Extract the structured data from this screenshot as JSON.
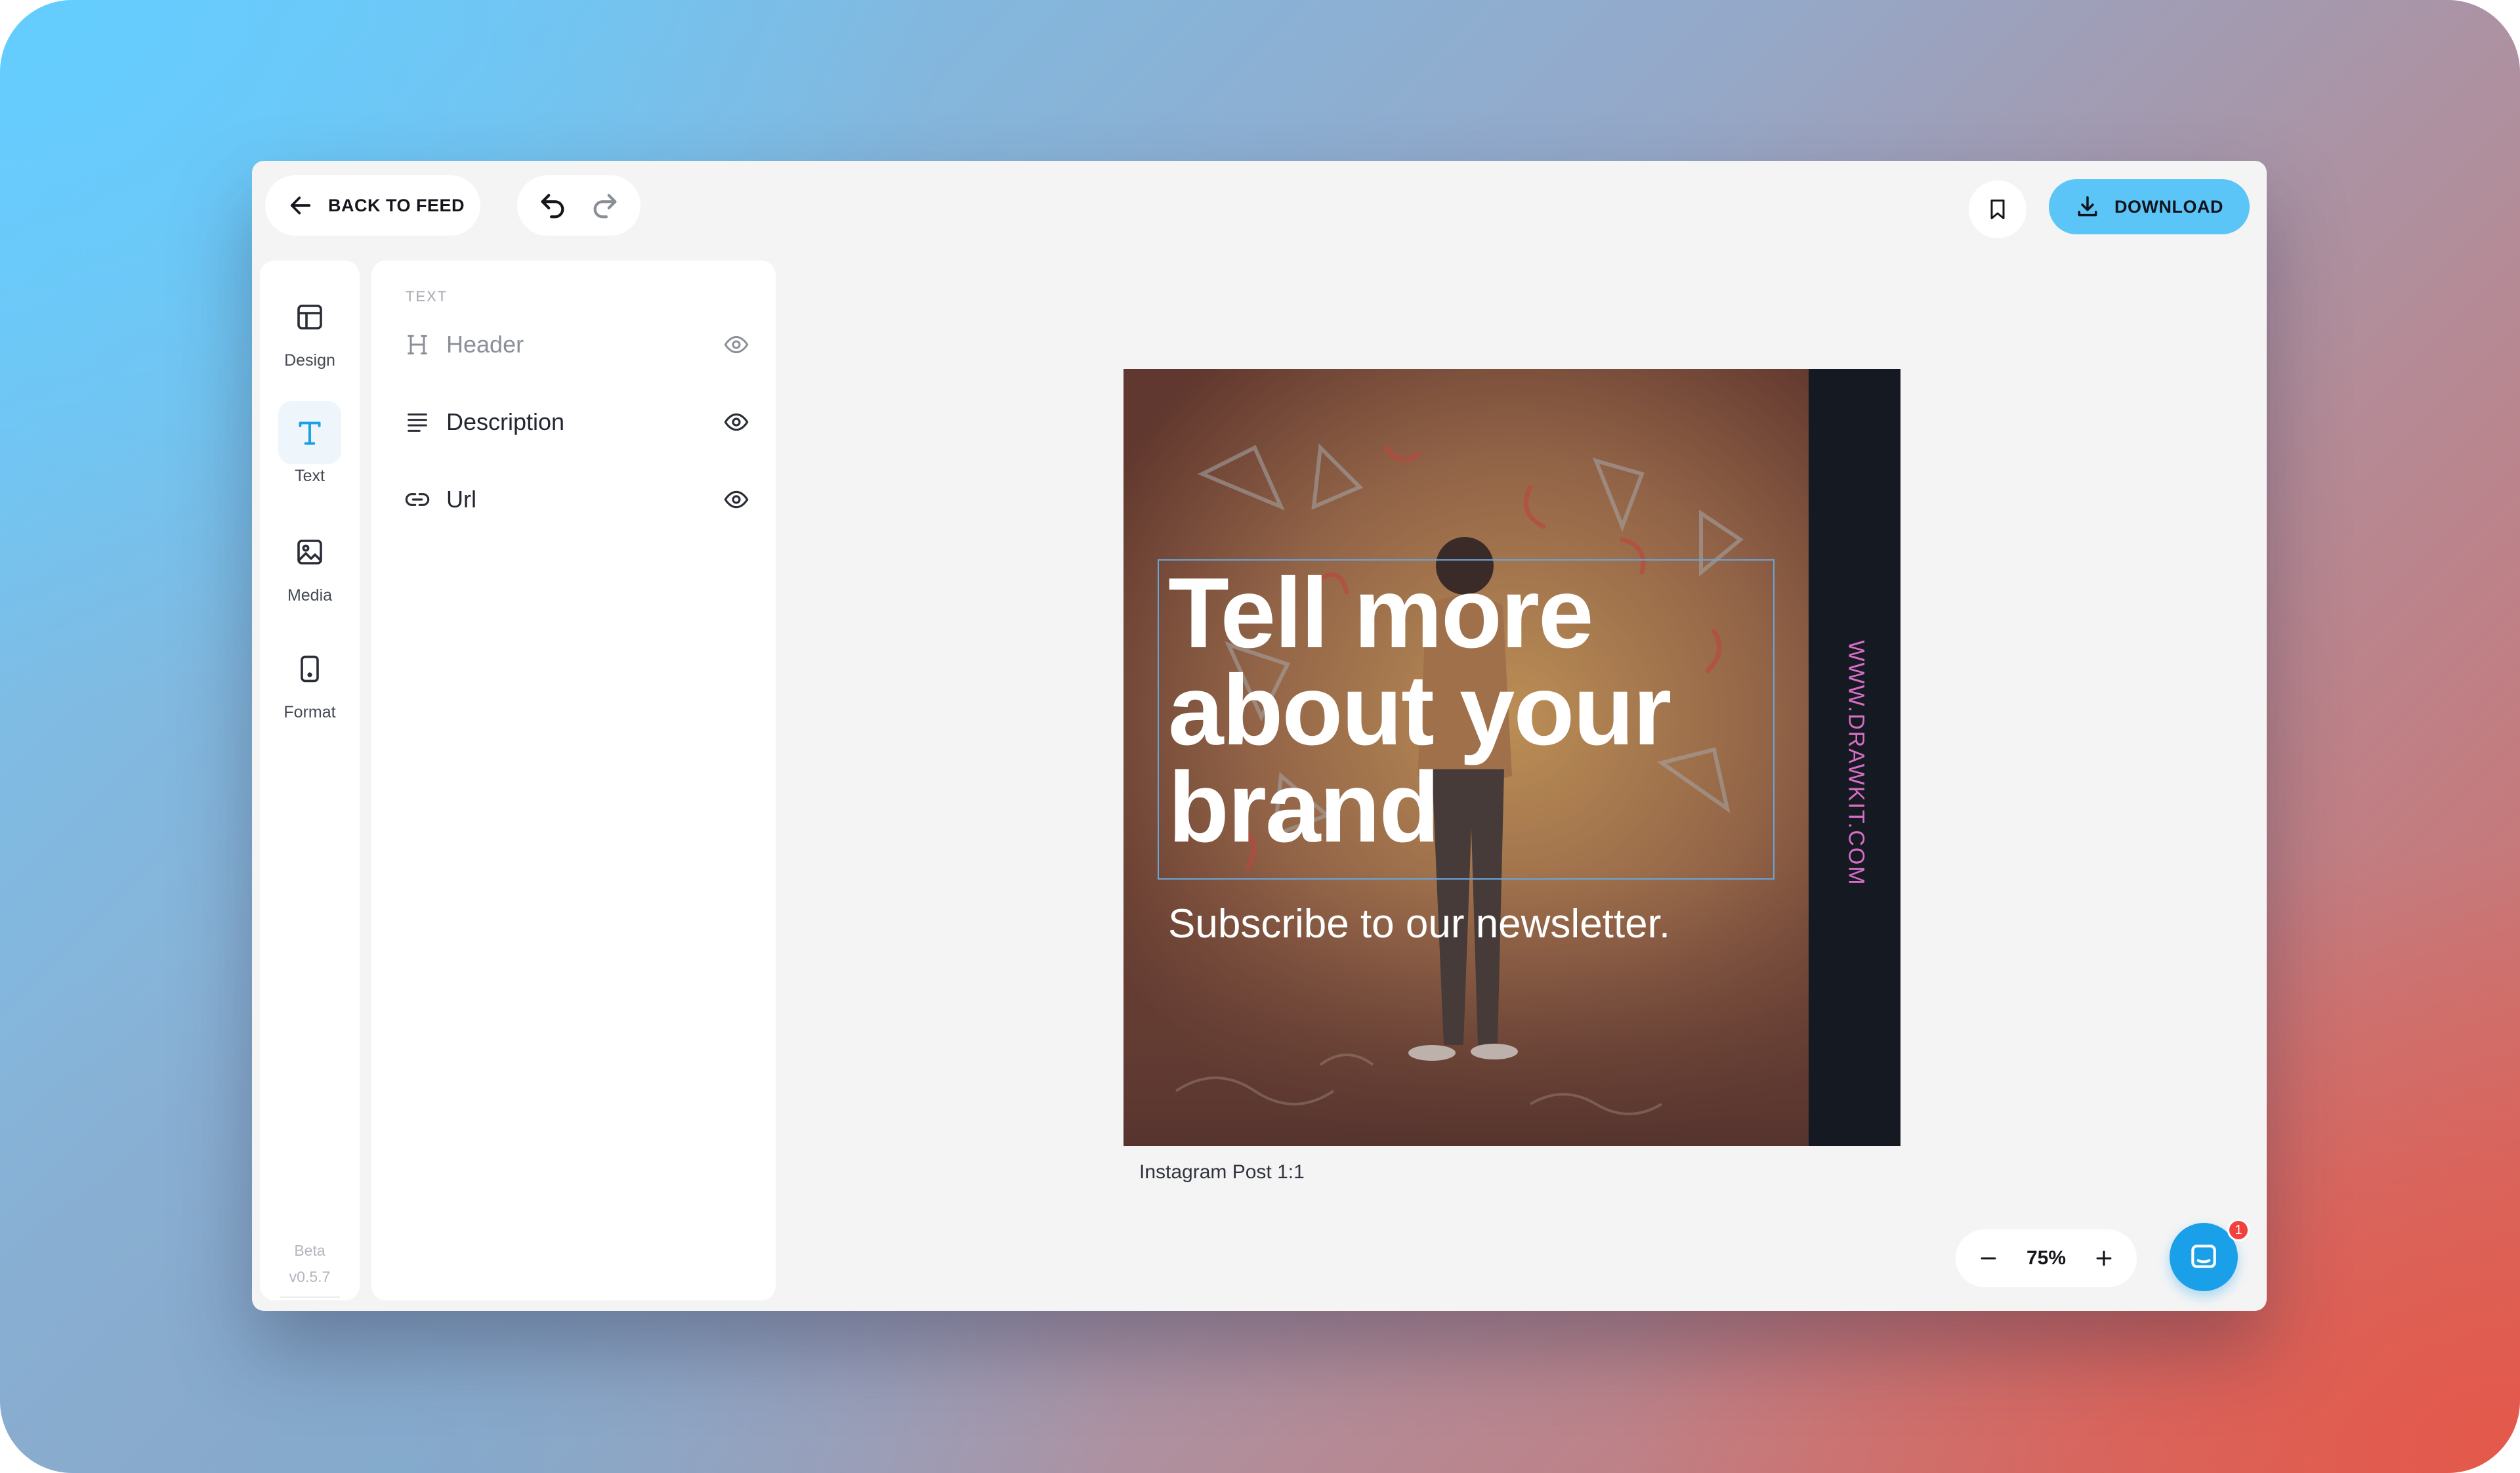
{
  "topbar": {
    "back_label": "BACK TO FEED",
    "download_label": "DOWNLOAD"
  },
  "sidebar": {
    "items": [
      {
        "label": "Design",
        "icon": "layout-icon"
      },
      {
        "label": "Text",
        "icon": "text-icon",
        "active": true
      },
      {
        "label": "Media",
        "icon": "image-icon"
      },
      {
        "label": "Format",
        "icon": "phone-icon"
      }
    ],
    "beta_label": "Beta",
    "version": "v0.5.7"
  },
  "panel": {
    "title": "TEXT",
    "rows": [
      {
        "label": "Header",
        "icon": "heading-icon",
        "dimmed": true
      },
      {
        "label": "Description",
        "icon": "paragraph-icon"
      },
      {
        "label": "Url",
        "icon": "link-icon"
      }
    ]
  },
  "artboard": {
    "headline_lines": [
      "Tell more",
      "about your",
      "brand"
    ],
    "subline": "Subscribe to our newsletter.",
    "url": "WWW.DRAWKIT.COM",
    "format_label": "Instagram Post 1:1"
  },
  "zoom": {
    "value": "75%"
  },
  "chat": {
    "badge": "1"
  },
  "colors": {
    "accent": "#5cc5f7",
    "chat": "#1aa0e8",
    "badge": "#f2423d",
    "url_text": "#d66ec5"
  }
}
